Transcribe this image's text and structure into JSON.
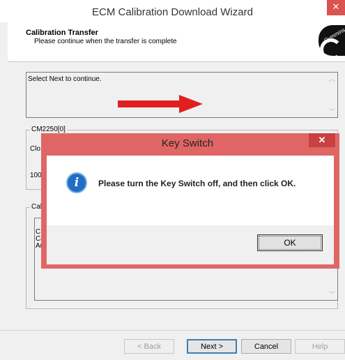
{
  "window": {
    "title": "ECM Calibration Download Wizard",
    "close_glyph": "✕"
  },
  "header": {
    "title": "Calibration Transfer",
    "subtitle": "Please continue when the transfer is complete",
    "logo_text": "Cummins",
    "logo_icon": "cummins-logo"
  },
  "status_box": {
    "text": "Select Next to continue."
  },
  "ecm_group": {
    "label": "CM2250[0]",
    "line1_partial": "Clo",
    "line2_partial": "100"
  },
  "calibration_group": {
    "label_partial": "Cali",
    "log_lines_partial": [
      "CI",
      "Ca",
      "Au"
    ]
  },
  "buttons": {
    "back": "< Back",
    "next": "Next >",
    "cancel": "Cancel",
    "help": "Help"
  },
  "dialog": {
    "title": "Key Switch",
    "close_glyph": "✕",
    "icon": "info-icon",
    "message": "Please turn the Key Switch off, and then click OK.",
    "ok_label": "OK"
  },
  "colors": {
    "dialog_frame": "#e06666",
    "annotation_arrow": "#e02020",
    "info_icon": "#1f6fc4"
  }
}
